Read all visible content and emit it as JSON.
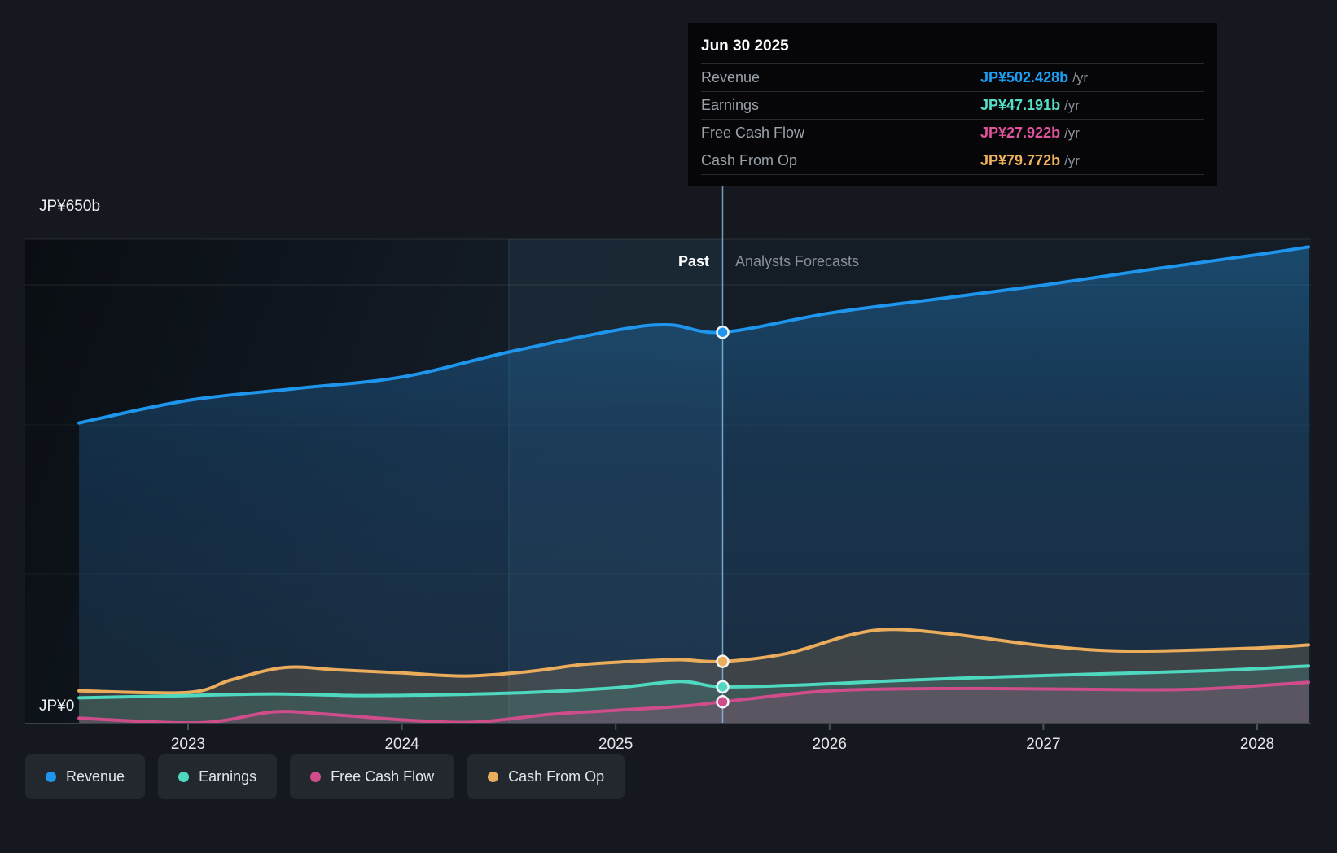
{
  "y_axis": {
    "top_label": "JP¥650b",
    "bottom_label": "JP¥0"
  },
  "x_axis": {
    "ticks": [
      {
        "label": "2023",
        "year": 2023
      },
      {
        "label": "2024",
        "year": 2024
      },
      {
        "label": "2025",
        "year": 2025
      },
      {
        "label": "2026",
        "year": 2026
      },
      {
        "label": "2027",
        "year": 2027
      },
      {
        "label": "2028",
        "year": 2028
      }
    ]
  },
  "sections": {
    "past": "Past",
    "forecast": "Analysts Forecasts"
  },
  "tooltip": {
    "date": "Jun 30 2025",
    "rows": [
      {
        "label": "Revenue",
        "value": "JP¥502.428b",
        "suffix": "/yr",
        "color": "#1C9FF4"
      },
      {
        "label": "Earnings",
        "value": "JP¥47.191b",
        "suffix": "/yr",
        "color": "#55E0C8"
      },
      {
        "label": "Free Cash Flow",
        "value": "JP¥27.922b",
        "suffix": "/yr",
        "color": "#E0549C"
      },
      {
        "label": "Cash From Op",
        "value": "JP¥79.772b",
        "suffix": "/yr",
        "color": "#F0B15F"
      }
    ]
  },
  "legend": [
    {
      "label": "Revenue",
      "color": "#1E96EE"
    },
    {
      "label": "Earnings",
      "color": "#4ED8BF"
    },
    {
      "label": "Free Cash Flow",
      "color": "#CE4D8A"
    },
    {
      "label": "Cash From Op",
      "color": "#EBAD5C"
    }
  ],
  "chart_data": {
    "type": "area",
    "title": "Earnings and Revenue Growth Forecast",
    "x_unit": "decimal_year",
    "xlim": [
      2022.49,
      2028.24
    ],
    "ylim": [
      0,
      650
    ],
    "currency_unit": "JP¥ billions",
    "grid": true,
    "legend_position": "bottom",
    "divider_x": 2025.5,
    "divider_date": "Jun 30 2025",
    "highlight_band_x": [
      2024.5,
      2025.5
    ],
    "series": [
      {
        "name": "Revenue",
        "color": "#1E96EE",
        "fill": "blue-gradient",
        "value_at_divider": 502.428,
        "points": [
          [
            2022.49,
            386
          ],
          [
            2023.0,
            415
          ],
          [
            2023.5,
            430
          ],
          [
            2024.0,
            445
          ],
          [
            2024.5,
            477
          ],
          [
            2025.0,
            505
          ],
          [
            2025.25,
            512
          ],
          [
            2025.5,
            502.428
          ],
          [
            2026.0,
            527
          ],
          [
            2026.5,
            545
          ],
          [
            2027.0,
            563
          ],
          [
            2027.5,
            583
          ],
          [
            2028.0,
            602
          ],
          [
            2028.24,
            612
          ]
        ]
      },
      {
        "name": "Cash From Op",
        "color": "#EBAD5C",
        "fill": "rgba(235,174,92,0.17)",
        "value_at_divider": 79.772,
        "points": [
          [
            2022.49,
            42
          ],
          [
            2023.0,
            40
          ],
          [
            2023.2,
            56
          ],
          [
            2023.45,
            72
          ],
          [
            2023.7,
            69
          ],
          [
            2024.0,
            65
          ],
          [
            2024.3,
            61
          ],
          [
            2024.6,
            67
          ],
          [
            2024.85,
            76
          ],
          [
            2025.1,
            80
          ],
          [
            2025.3,
            82
          ],
          [
            2025.5,
            79.772
          ],
          [
            2025.8,
            90
          ],
          [
            2026.1,
            114
          ],
          [
            2026.3,
            121
          ],
          [
            2026.6,
            114
          ],
          [
            2027.0,
            100
          ],
          [
            2027.4,
            93
          ],
          [
            2028.0,
            97
          ],
          [
            2028.24,
            101
          ]
        ]
      },
      {
        "name": "Earnings",
        "color": "#4ED8BF",
        "fill": "rgba(80,216,192,0.14)",
        "value_at_divider": 47.191,
        "points": [
          [
            2022.49,
            33
          ],
          [
            2023.0,
            36
          ],
          [
            2023.4,
            38
          ],
          [
            2023.8,
            36
          ],
          [
            2024.2,
            37
          ],
          [
            2024.6,
            40
          ],
          [
            2025.0,
            46
          ],
          [
            2025.3,
            54
          ],
          [
            2025.5,
            47.191
          ],
          [
            2025.9,
            50
          ],
          [
            2026.3,
            55
          ],
          [
            2026.8,
            60
          ],
          [
            2027.3,
            64
          ],
          [
            2027.8,
            68
          ],
          [
            2028.24,
            74
          ]
        ]
      },
      {
        "name": "Free Cash Flow",
        "color": "#CE4D8A",
        "fill": "rgba(212,82,143,0.18)",
        "value_at_divider": 27.922,
        "points": [
          [
            2022.49,
            7
          ],
          [
            2023.05,
            1
          ],
          [
            2023.4,
            15
          ],
          [
            2023.65,
            12
          ],
          [
            2024.05,
            4
          ],
          [
            2024.35,
            2
          ],
          [
            2024.7,
            12
          ],
          [
            2025.0,
            17
          ],
          [
            2025.3,
            22
          ],
          [
            2025.5,
            27.922
          ],
          [
            2025.9,
            40
          ],
          [
            2026.2,
            44
          ],
          [
            2026.7,
            45
          ],
          [
            2027.2,
            44
          ],
          [
            2027.7,
            44
          ],
          [
            2028.24,
            53
          ]
        ]
      }
    ]
  }
}
